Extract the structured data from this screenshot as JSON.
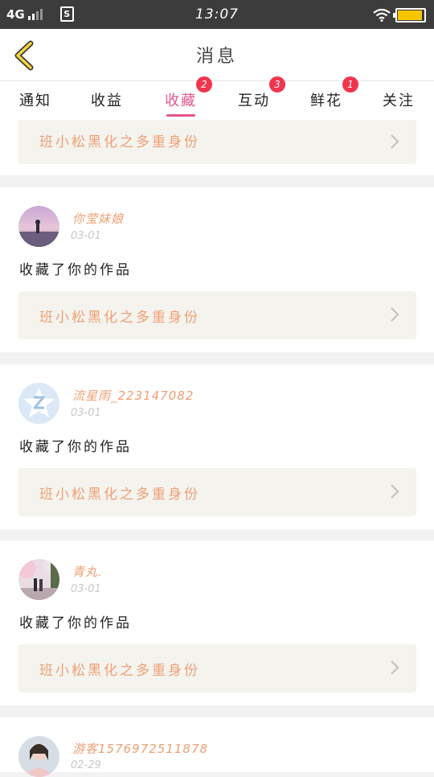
{
  "status_bar": {
    "network": "4G",
    "sim_label": "S",
    "time": "13:07"
  },
  "header": {
    "title": "消息",
    "back_icon": "chevron-left-icon"
  },
  "tabs": [
    {
      "label": "通知",
      "badge": ""
    },
    {
      "label": "收益",
      "badge": ""
    },
    {
      "label": "收藏",
      "badge": "2",
      "active": true
    },
    {
      "label": "互动",
      "badge": "3"
    },
    {
      "label": "鲜花",
      "badge": "1"
    },
    {
      "label": "关注",
      "badge": ""
    }
  ],
  "colors": {
    "accent": "#e4558f",
    "badge": "#f2354f",
    "username": "#ef9f74",
    "work_title": "#ef9f74",
    "work_box": "#f4f3ee"
  },
  "top_work": {
    "title": "班小松黑化之多重身份"
  },
  "items": [
    {
      "username": "你莹妹娘",
      "date": "03-01",
      "action": "收藏了你的作品",
      "work_title": "班小松黑化之多重身份"
    },
    {
      "username": "流星雨_223147082",
      "date": "03-01",
      "action": "收藏了你的作品",
      "work_title": "班小松黑化之多重身份"
    },
    {
      "username": "青丸.",
      "date": "03-01",
      "action": "收藏了你的作品",
      "work_title": "班小松黑化之多重身份"
    },
    {
      "username": "游客1576972511878",
      "date": "02-29"
    }
  ]
}
